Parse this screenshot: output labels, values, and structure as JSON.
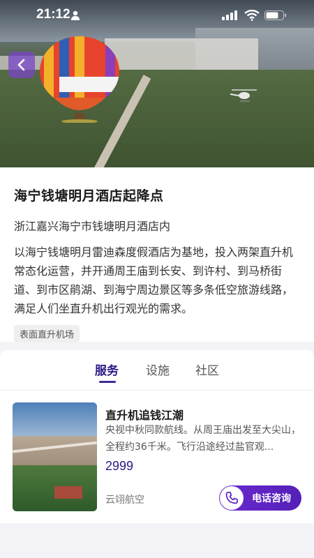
{
  "status_bar": {
    "time": "21:12"
  },
  "hero": {
    "image_subject": "hot-air-balloon-and-helicopter-landing-field",
    "back_icon": "chevron-left-icon"
  },
  "info": {
    "title": "海宁钱塘明月酒店起降点",
    "address": "浙江嘉兴海宁市钱塘明月酒店内",
    "description": "以海宁钱塘明月雷迪森度假酒店为基地，投入两架直升机常态化运营，并开通周王庙到长安、到许村、到马桥街道、到市区鹃湖、到海宁周边景区等多条低空旅游线路，满足人们坐直升机出行观光的需求。",
    "tag": "表面直升机场"
  },
  "tabs": {
    "items": [
      {
        "label": "服务",
        "active": true
      },
      {
        "label": "设施",
        "active": false
      },
      {
        "label": "社区",
        "active": false
      }
    ]
  },
  "service": {
    "title": "直升机追钱江潮",
    "description": "央视中秋同款航线。从周王庙出发至大尖山，全程约36千米。飞行沿途经过盐官观...",
    "price": "2999",
    "provider": "云翊航空",
    "call_button_label": "电话咨询",
    "call_icon": "phone-icon"
  },
  "colors": {
    "accent": "#5a22c0",
    "accent_text": "#2a1a8a"
  }
}
